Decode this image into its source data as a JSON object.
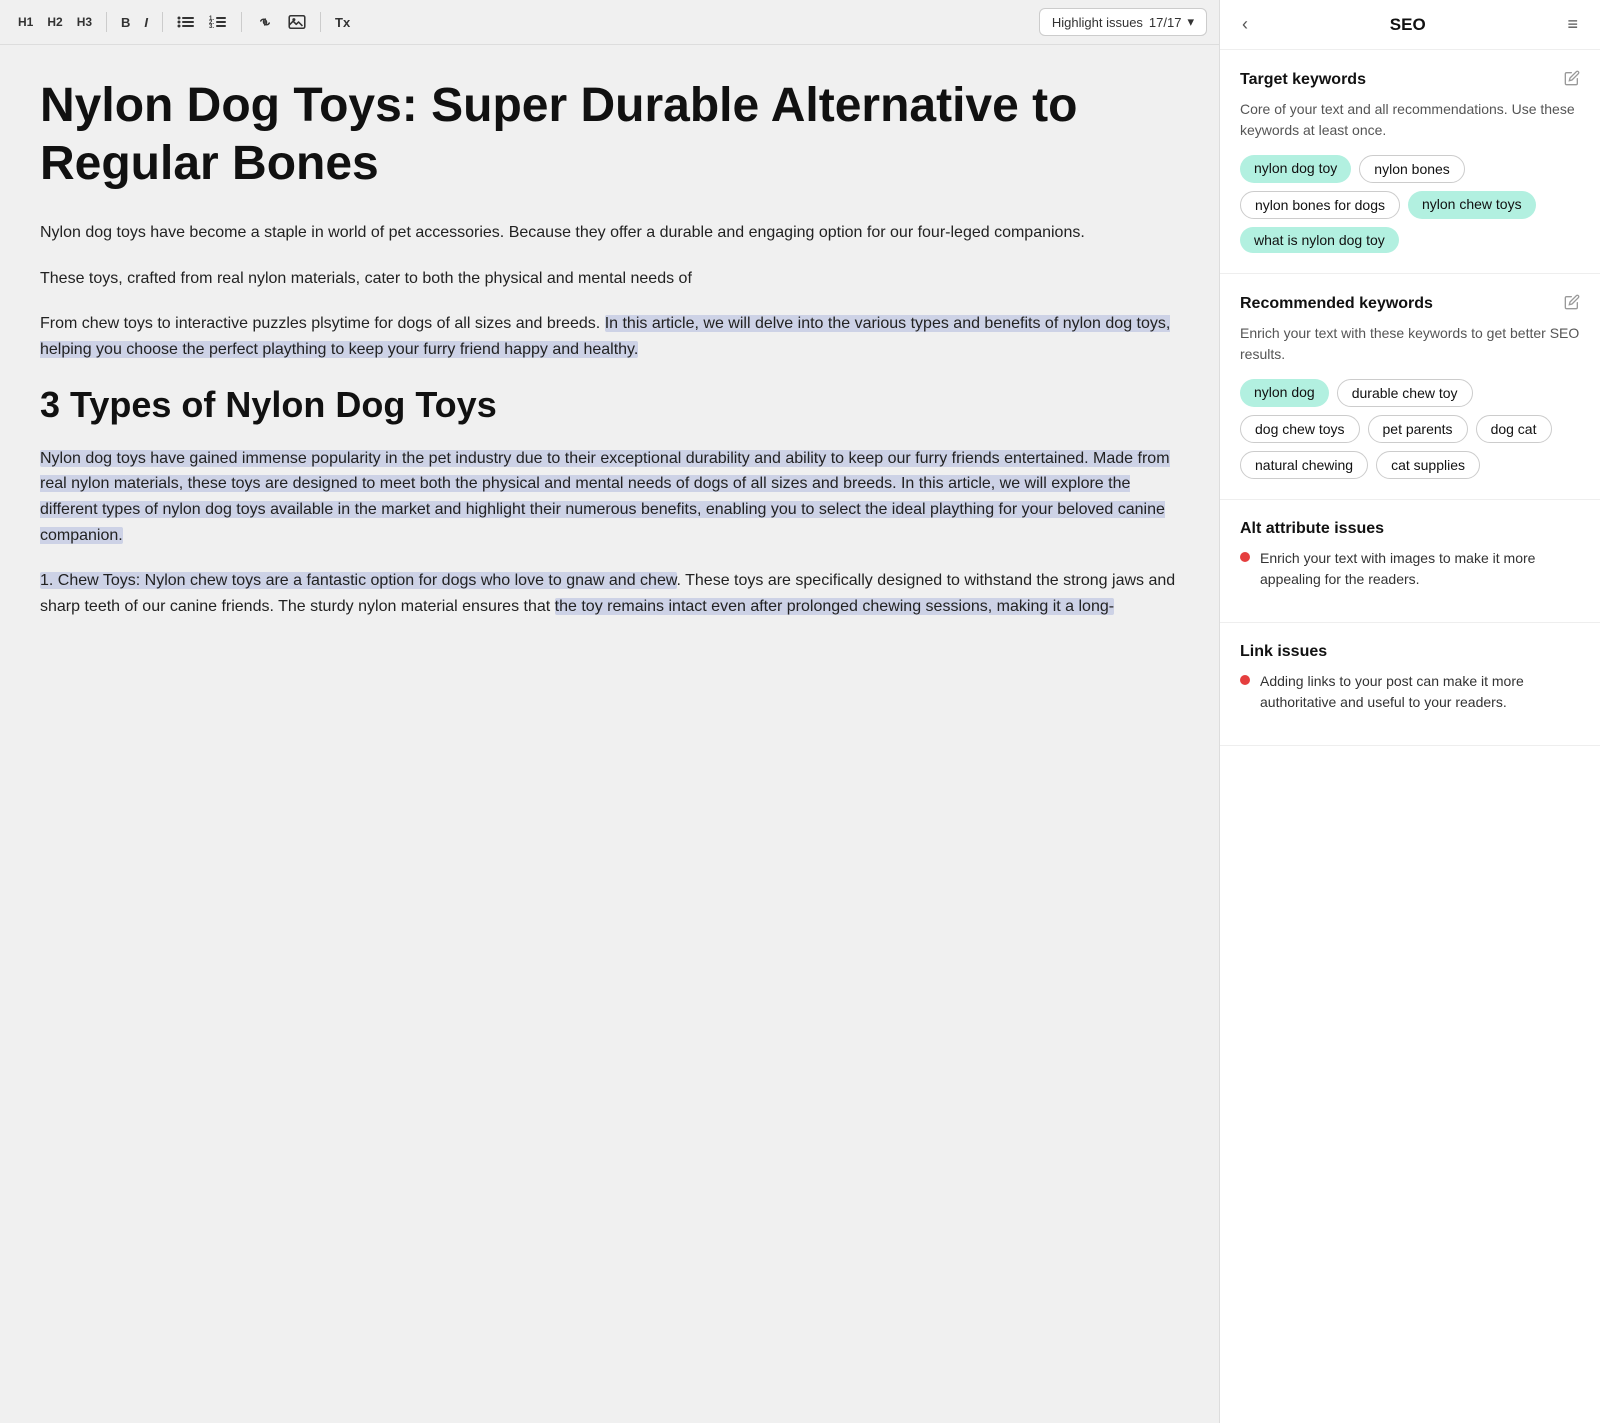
{
  "toolbar": {
    "h1_label": "H1",
    "h2_label": "H2",
    "h3_label": "H3",
    "bold_label": "B",
    "italic_label": "I",
    "ul_icon": "☰",
    "ol_icon": "☰",
    "link_icon": "🔗",
    "image_icon": "🖼",
    "clear_icon": "Tx",
    "highlight_label": "Highlight issues",
    "highlight_count": "17/17",
    "highlight_chevron": "▾"
  },
  "editor": {
    "h1": "Nylon Dog Toys: Super Durable Alternative to Regular Bones",
    "p1": "Nylon dog toys have become a staple in world of pet accessories. Because they offer a durable and engaging option for our four-leged companions.",
    "p2": "These toys, crafted from real nylon materials, cater to both the physical and mental needs of",
    "p3_plain": "From chew toys to interactive puzzles plsytime for dogs of all sizes and breeds. ",
    "p3_highlight": "In this article, we will delve into the various types and benefits of nylon dog toys, helping you choose the perfect plaything to keep your furry friend happy and healthy.",
    "h2": "3 Types of Nylon Dog Toys",
    "p4_highlight": "Nylon dog toys have gained immense popularity in the pet industry due to their exceptional durability and ability to keep our furry friends entertained. Made from real nylon materials, these toys are designed to meet both the physical and mental needs of dogs of all sizes and breeds. In this article, we will explore the different types of nylon dog toys available in the market and highlight their numerous benefits, enabling you to select the ideal plaything for your beloved canine companion.",
    "p5_start": "1. Chew Toys: Nylon chew toys are a fantastic option for dogs who love to gnaw and chew",
    "p5_rest": ". These toys are specifically designed to withstand the strong jaws and sharp teeth of our canine friends. The sturdy nylon material ensures that ",
    "p5_end": "the toy remains intact even after prolonged chewing sessions, making it a long-"
  },
  "seo_panel": {
    "title": "SEO",
    "back_icon": "‹",
    "menu_icon": "≡",
    "target_keywords": {
      "section_title": "Target keywords",
      "description": "Core of your text and all recommendations. Use these keywords at least once.",
      "tags": [
        {
          "label": "nylon dog toy",
          "active": true
        },
        {
          "label": "nylon bones",
          "active": false
        },
        {
          "label": "nylon bones for dogs",
          "active": false
        },
        {
          "label": "nylon chew toys",
          "active": true
        },
        {
          "label": "what is nylon dog toy",
          "active": true
        }
      ]
    },
    "recommended_keywords": {
      "section_title": "Recommended keywords",
      "description": "Enrich your text with these keywords to get better SEO results.",
      "tags": [
        {
          "label": "nylon dog",
          "active": true
        },
        {
          "label": "durable chew toy",
          "active": false
        },
        {
          "label": "dog chew toys",
          "active": false
        },
        {
          "label": "pet parents",
          "active": false
        },
        {
          "label": "dog cat",
          "active": false
        },
        {
          "label": "natural chewing",
          "active": false
        },
        {
          "label": "cat supplies",
          "active": false
        }
      ]
    },
    "alt_attribute_issues": {
      "section_title": "Alt attribute issues",
      "issues": [
        "Enrich your text with images to make it more appealing for the readers."
      ]
    },
    "link_issues": {
      "section_title": "Link issues",
      "issues": [
        "Adding links to your post can make it more authoritative and useful to your readers."
      ]
    }
  }
}
